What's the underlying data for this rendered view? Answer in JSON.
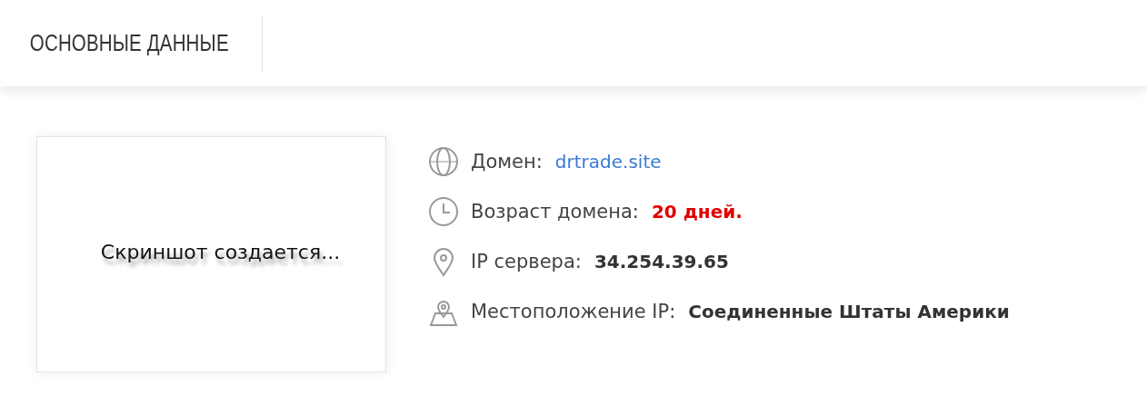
{
  "header": {
    "title": "ОСНОВНЫЕ ДАННЫЕ"
  },
  "screenshot": {
    "caption": "Скриншот создается..."
  },
  "details": [
    {
      "label": "Домен:",
      "value": "drtrade.site",
      "kind": "link"
    },
    {
      "label": "Возраст домена:",
      "value": "20 дней.",
      "kind": "alert"
    },
    {
      "label": "IP сервера:",
      "value": "34.254.39.65",
      "kind": "plain"
    },
    {
      "label": "Местоположение IP:",
      "value": "Соединенные Штаты Америки",
      "kind": "plain"
    }
  ]
}
